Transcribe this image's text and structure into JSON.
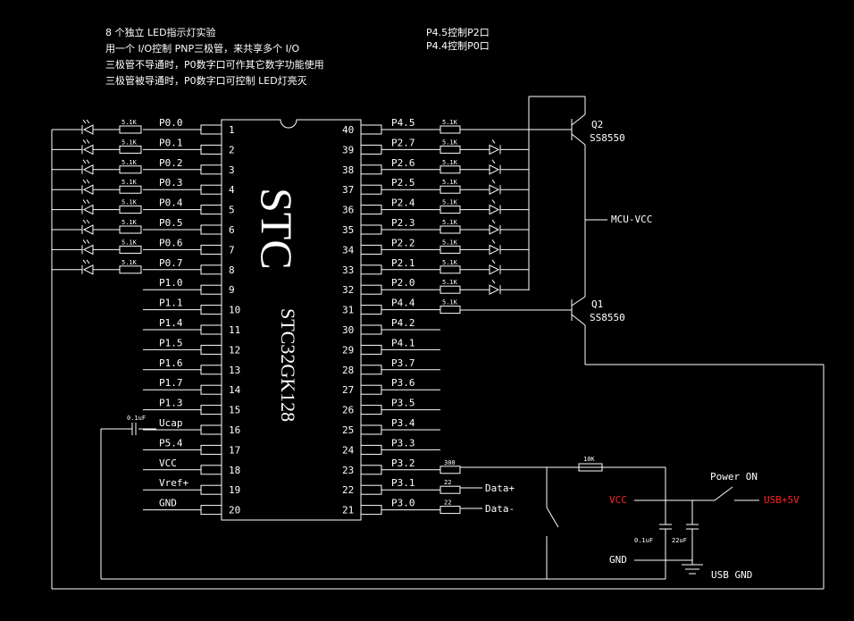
{
  "notes": [
    "8 个独立 LED指示灯实验",
    "用一个 I/O控制 PNP三极管，来共享多个 I/O",
    "三极管不导通时，P0数字口可作其它数字功能使用",
    "三极管被导通时，P0数字口可控制 LED灯亮灭"
  ],
  "notes_right": [
    "P4.5控制P2口",
    "P4.4控制P0口"
  ],
  "chip": {
    "brand": "STC",
    "model": "STC32GK128"
  },
  "left_pins": [
    {
      "num": "1",
      "name": "P0.0"
    },
    {
      "num": "2",
      "name": "P0.1"
    },
    {
      "num": "3",
      "name": "P0.2"
    },
    {
      "num": "4",
      "name": "P0.3"
    },
    {
      "num": "5",
      "name": "P0.4"
    },
    {
      "num": "6",
      "name": "P0.5"
    },
    {
      "num": "7",
      "name": "P0.6"
    },
    {
      "num": "8",
      "name": "P0.7"
    },
    {
      "num": "9",
      "name": "P1.0"
    },
    {
      "num": "10",
      "name": "P1.1"
    },
    {
      "num": "11",
      "name": "P1.4"
    },
    {
      "num": "12",
      "name": "P1.5"
    },
    {
      "num": "13",
      "name": "P1.6"
    },
    {
      "num": "14",
      "name": "P1.7"
    },
    {
      "num": "15",
      "name": "P1.3"
    },
    {
      "num": "16",
      "name": "Ucap"
    },
    {
      "num": "17",
      "name": "P5.4"
    },
    {
      "num": "18",
      "name": "VCC"
    },
    {
      "num": "19",
      "name": "Vref+"
    },
    {
      "num": "20",
      "name": "GND"
    }
  ],
  "right_pins": [
    {
      "num": "40",
      "name": "P4.5"
    },
    {
      "num": "39",
      "name": "P2.7"
    },
    {
      "num": "38",
      "name": "P2.6"
    },
    {
      "num": "37",
      "name": "P2.5"
    },
    {
      "num": "36",
      "name": "P2.4"
    },
    {
      "num": "35",
      "name": "P2.3"
    },
    {
      "num": "34",
      "name": "P2.2"
    },
    {
      "num": "33",
      "name": "P2.1"
    },
    {
      "num": "32",
      "name": "P2.0"
    },
    {
      "num": "31",
      "name": "P4.4"
    },
    {
      "num": "30",
      "name": "P4.2"
    },
    {
      "num": "29",
      "name": "P4.1"
    },
    {
      "num": "28",
      "name": "P3.7"
    },
    {
      "num": "27",
      "name": "P3.6"
    },
    {
      "num": "26",
      "name": "P3.5"
    },
    {
      "num": "25",
      "name": "P3.4"
    },
    {
      "num": "24",
      "name": "P3.3"
    },
    {
      "num": "23",
      "name": "P3.2"
    },
    {
      "num": "22",
      "name": "P3.1"
    },
    {
      "num": "21",
      "name": "P3.0"
    }
  ],
  "resistors": {
    "led": "5.1K",
    "r300": "300",
    "r22": "22",
    "r10k": "10K"
  },
  "capacitors": {
    "ucap": "0.1uF",
    "c1": "0.1uF",
    "c2": "22uF"
  },
  "transistors": [
    {
      "ref": "Q2",
      "type": "SS8550"
    },
    {
      "ref": "Q1",
      "type": "SS8550"
    }
  ],
  "labels": {
    "mcu_vcc": "MCU-VCC",
    "data_plus": "Data+",
    "data_minus": "Data-",
    "power_on": "Power ON",
    "vcc": "VCC",
    "usb5v": "USB+5V",
    "gnd": "GND",
    "usb_gnd": "USB GND"
  },
  "colors": {
    "background": "#000000",
    "line": "#ffffff",
    "power": "#ff2020"
  }
}
